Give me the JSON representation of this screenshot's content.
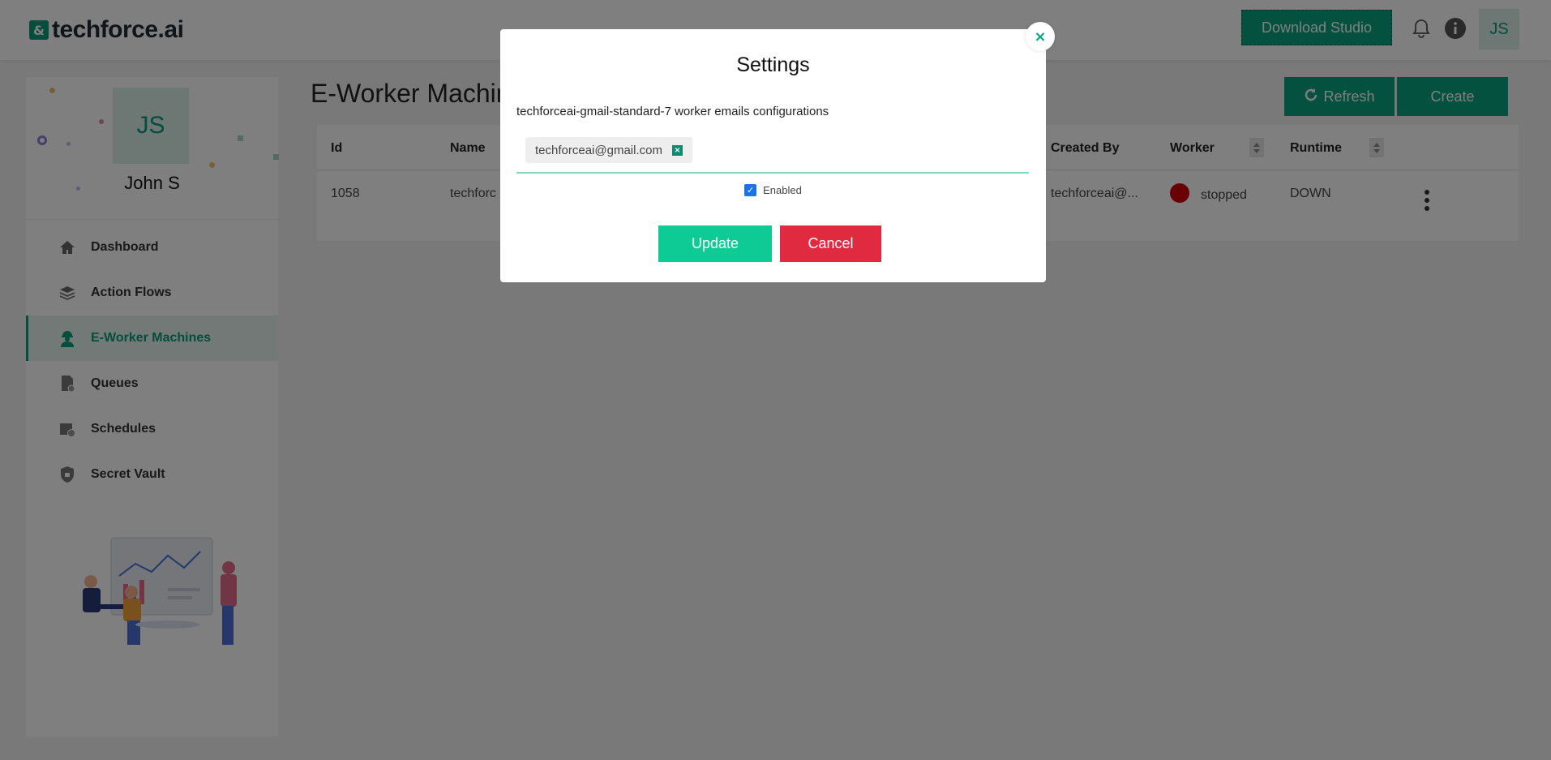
{
  "header": {
    "logo_text": "techforce.ai",
    "download_label": "Download Studio",
    "avatar_initials": "JS"
  },
  "sidebar": {
    "profile": {
      "initials": "JS",
      "name": "John S"
    },
    "items": [
      {
        "label": "Dashboard",
        "icon": "home-icon",
        "active": false
      },
      {
        "label": "Action Flows",
        "icon": "layers-icon",
        "active": false
      },
      {
        "label": "E-Worker Machines",
        "icon": "worker-icon",
        "active": true
      },
      {
        "label": "Queues",
        "icon": "queue-icon",
        "active": false
      },
      {
        "label": "Schedules",
        "icon": "schedule-icon",
        "active": false
      },
      {
        "label": "Secret Vault",
        "icon": "vault-icon",
        "active": false
      }
    ]
  },
  "main": {
    "title": "E-Worker Machines",
    "refresh_label": "Refresh",
    "create_label": "Create",
    "table": {
      "headers": [
        "Id",
        "Name",
        "Created By",
        "Worker",
        "Runtime"
      ],
      "rows": [
        {
          "id": "1058",
          "name": "techforc",
          "created_by": "techforceai@...",
          "worker_status": "stopped",
          "runtime": "DOWN"
        }
      ]
    }
  },
  "modal": {
    "title": "Settings",
    "description": "techforceai-gmail-standard-7 worker emails configurations",
    "emails": [
      "techforceai@gmail.com"
    ],
    "enabled_label": "Enabled",
    "enabled": true,
    "update_label": "Update",
    "cancel_label": "Cancel"
  },
  "colors": {
    "brand": "#0aa37f",
    "danger": "#e02a3f",
    "status_stopped": "#d0000c"
  }
}
